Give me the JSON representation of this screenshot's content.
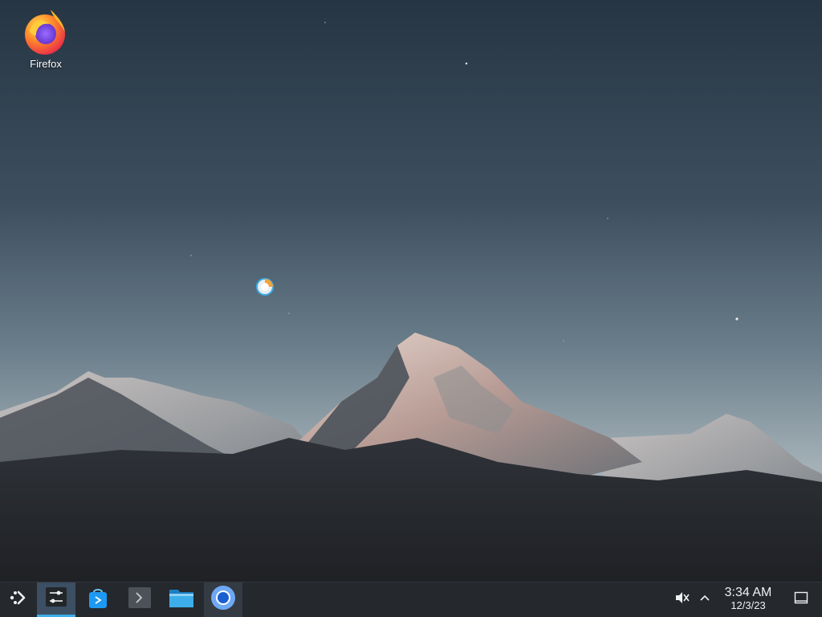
{
  "desktop": {
    "icons": [
      {
        "label": "Firefox",
        "icon": "firefox-icon"
      }
    ]
  },
  "taskbar": {
    "launcher_icon": "application-launcher-icon",
    "tasks": [
      {
        "icon": "system-settings-icon",
        "state": "active"
      },
      {
        "icon": "discover-store-icon",
        "state": "idle"
      },
      {
        "icon": "terminal-icon",
        "state": "idle"
      },
      {
        "icon": "file-manager-icon",
        "state": "idle"
      },
      {
        "icon": "chromium-icon",
        "state": "open"
      }
    ],
    "tray": {
      "volume_icon": "volume-muted-icon",
      "expand_icon": "chevron-up-icon",
      "show_desktop_icon": "show-desktop-icon"
    },
    "clock": {
      "time": "3:34 AM",
      "date": "12/3/23"
    }
  },
  "colors": {
    "taskbar_bg": "#25282d",
    "active_accent": "#3daee9",
    "sky_top": "#2b3a48",
    "sky_horizon": "#9aa9b2"
  }
}
